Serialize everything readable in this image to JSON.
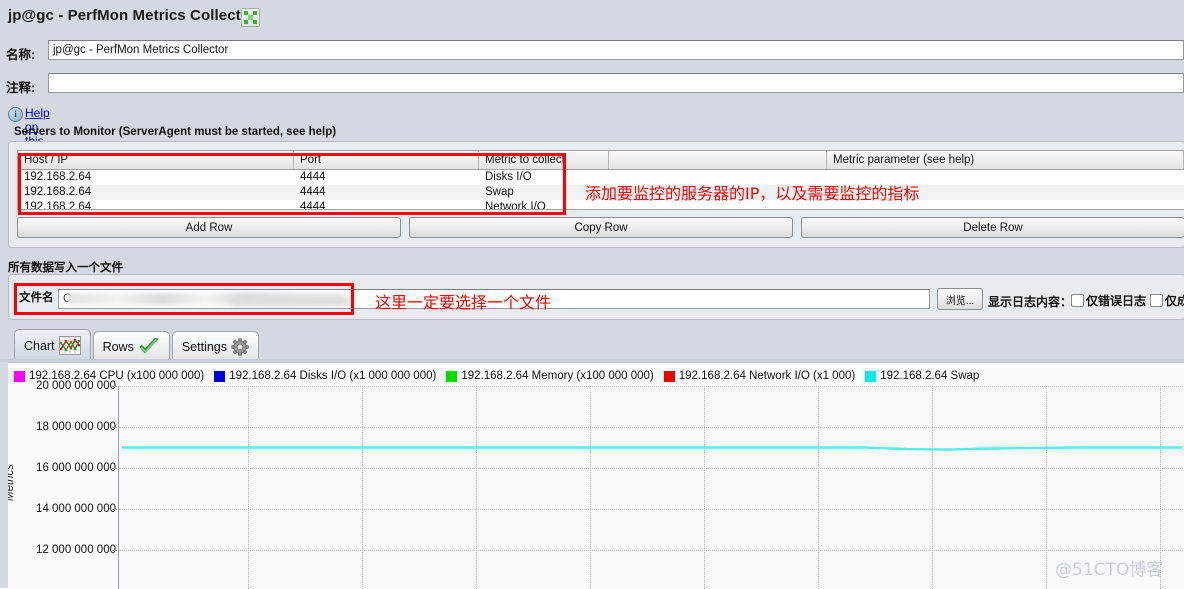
{
  "window": {
    "title": "jp@gc - PerfMon Metrics Collector",
    "expand_icon": "expand-icon"
  },
  "form": {
    "name_label": "名称:",
    "name_value": "jp@gc - PerfMon Metrics Collector",
    "comment_label": "注释:",
    "comment_value": ""
  },
  "help": {
    "info_glyph": "i",
    "link_text": "Help on this plugin"
  },
  "servers": {
    "caption": "Servers to Monitor (ServerAgent must be started, see help)",
    "columns": [
      "Host / IP",
      "Port",
      "Metric to collect",
      "",
      "Metric parameter (see help)"
    ],
    "rows": [
      {
        "host": "192.168.2.64",
        "port": "4444",
        "metric": "Disks I/O",
        "blank": "",
        "param": ""
      },
      {
        "host": "192.168.2.64",
        "port": "4444",
        "metric": "Swap",
        "blank": "",
        "param": ""
      },
      {
        "host": "192.168.2.64",
        "port": "4444",
        "metric": "Network I/O",
        "blank": "",
        "param": ""
      }
    ],
    "buttons": {
      "add": "Add Row",
      "copy": "Copy Row",
      "delete": "Delete Row"
    }
  },
  "file_section": {
    "caption": "所有数据写入一个文件",
    "filename_label": "文件名",
    "filename_value": "C",
    "browse_button": "浏览...",
    "log_label": "显示日志内容：",
    "checkbox_1": "仅错误日志",
    "checkbox_2": "仅成"
  },
  "annotations": {
    "table_note": "添加要监控的服务器的IP，以及需要监控的指标",
    "file_note": "这里一定要选择一个文件",
    "color": "#ff0000"
  },
  "tabs": [
    {
      "label": "Chart",
      "icon": "line-chart-icon",
      "active": true
    },
    {
      "label": "Rows",
      "icon": "green-check-icon",
      "active": false
    },
    {
      "label": "Settings",
      "icon": "gear-icon",
      "active": false
    }
  ],
  "watermark": "@51CTO博客",
  "chart_data": {
    "type": "line",
    "title": "",
    "xlabel": "",
    "ylabel": "Metrics",
    "ylim": [
      11000000000,
      20500000000
    ],
    "yticks": [
      "20 000 000 000",
      "18 000 000 000",
      "16 000 000 000",
      "14 000 000 000",
      "12 000 000 000"
    ],
    "ytick_values": [
      20000000000,
      18000000000,
      16000000000,
      14000000000,
      12000000000
    ],
    "grid": true,
    "legend_position": "top-left",
    "legend": [
      {
        "label": "192.168.2.64 CPU (x100 000 000)",
        "color": "#ff00ff"
      },
      {
        "label": "192.168.2.64 Disks I/O (x1 000 000 000)",
        "color": "#0000dd"
      },
      {
        "label": "192.168.2.64 Memory (x100 000 000)",
        "color": "#00dd00"
      },
      {
        "label": "192.168.2.64 Network I/O (x1 000)",
        "color": "#ee0000"
      },
      {
        "label": "192.168.2.64 Swap",
        "color": "#00eeee"
      }
    ],
    "series": [
      {
        "name": "192.168.2.64 Swap",
        "color": "#55eeee",
        "x": [
          0,
          10,
          20,
          30,
          40,
          50,
          60,
          70,
          74,
          78,
          82,
          90,
          100
        ],
        "values": [
          17000000000,
          17000000000,
          17000000000,
          17000000000,
          17000000000,
          17000000000,
          17000000000,
          17000000000,
          16920000000,
          16900000000,
          16950000000,
          17000000000,
          17000000000
        ]
      },
      {
        "name": "192.168.2.64 CPU (x100 000 000)",
        "color": "#ff00ff",
        "x": [],
        "values": []
      },
      {
        "name": "192.168.2.64 Disks I/O (x1 000 000 000)",
        "color": "#0000dd",
        "x": [],
        "values": []
      },
      {
        "name": "192.168.2.64 Memory (x100 000 000)",
        "color": "#00dd00",
        "x": [],
        "values": []
      },
      {
        "name": "192.168.2.64 Network I/O (x1 000)",
        "color": "#ee0000",
        "x": [],
        "values": []
      }
    ]
  }
}
